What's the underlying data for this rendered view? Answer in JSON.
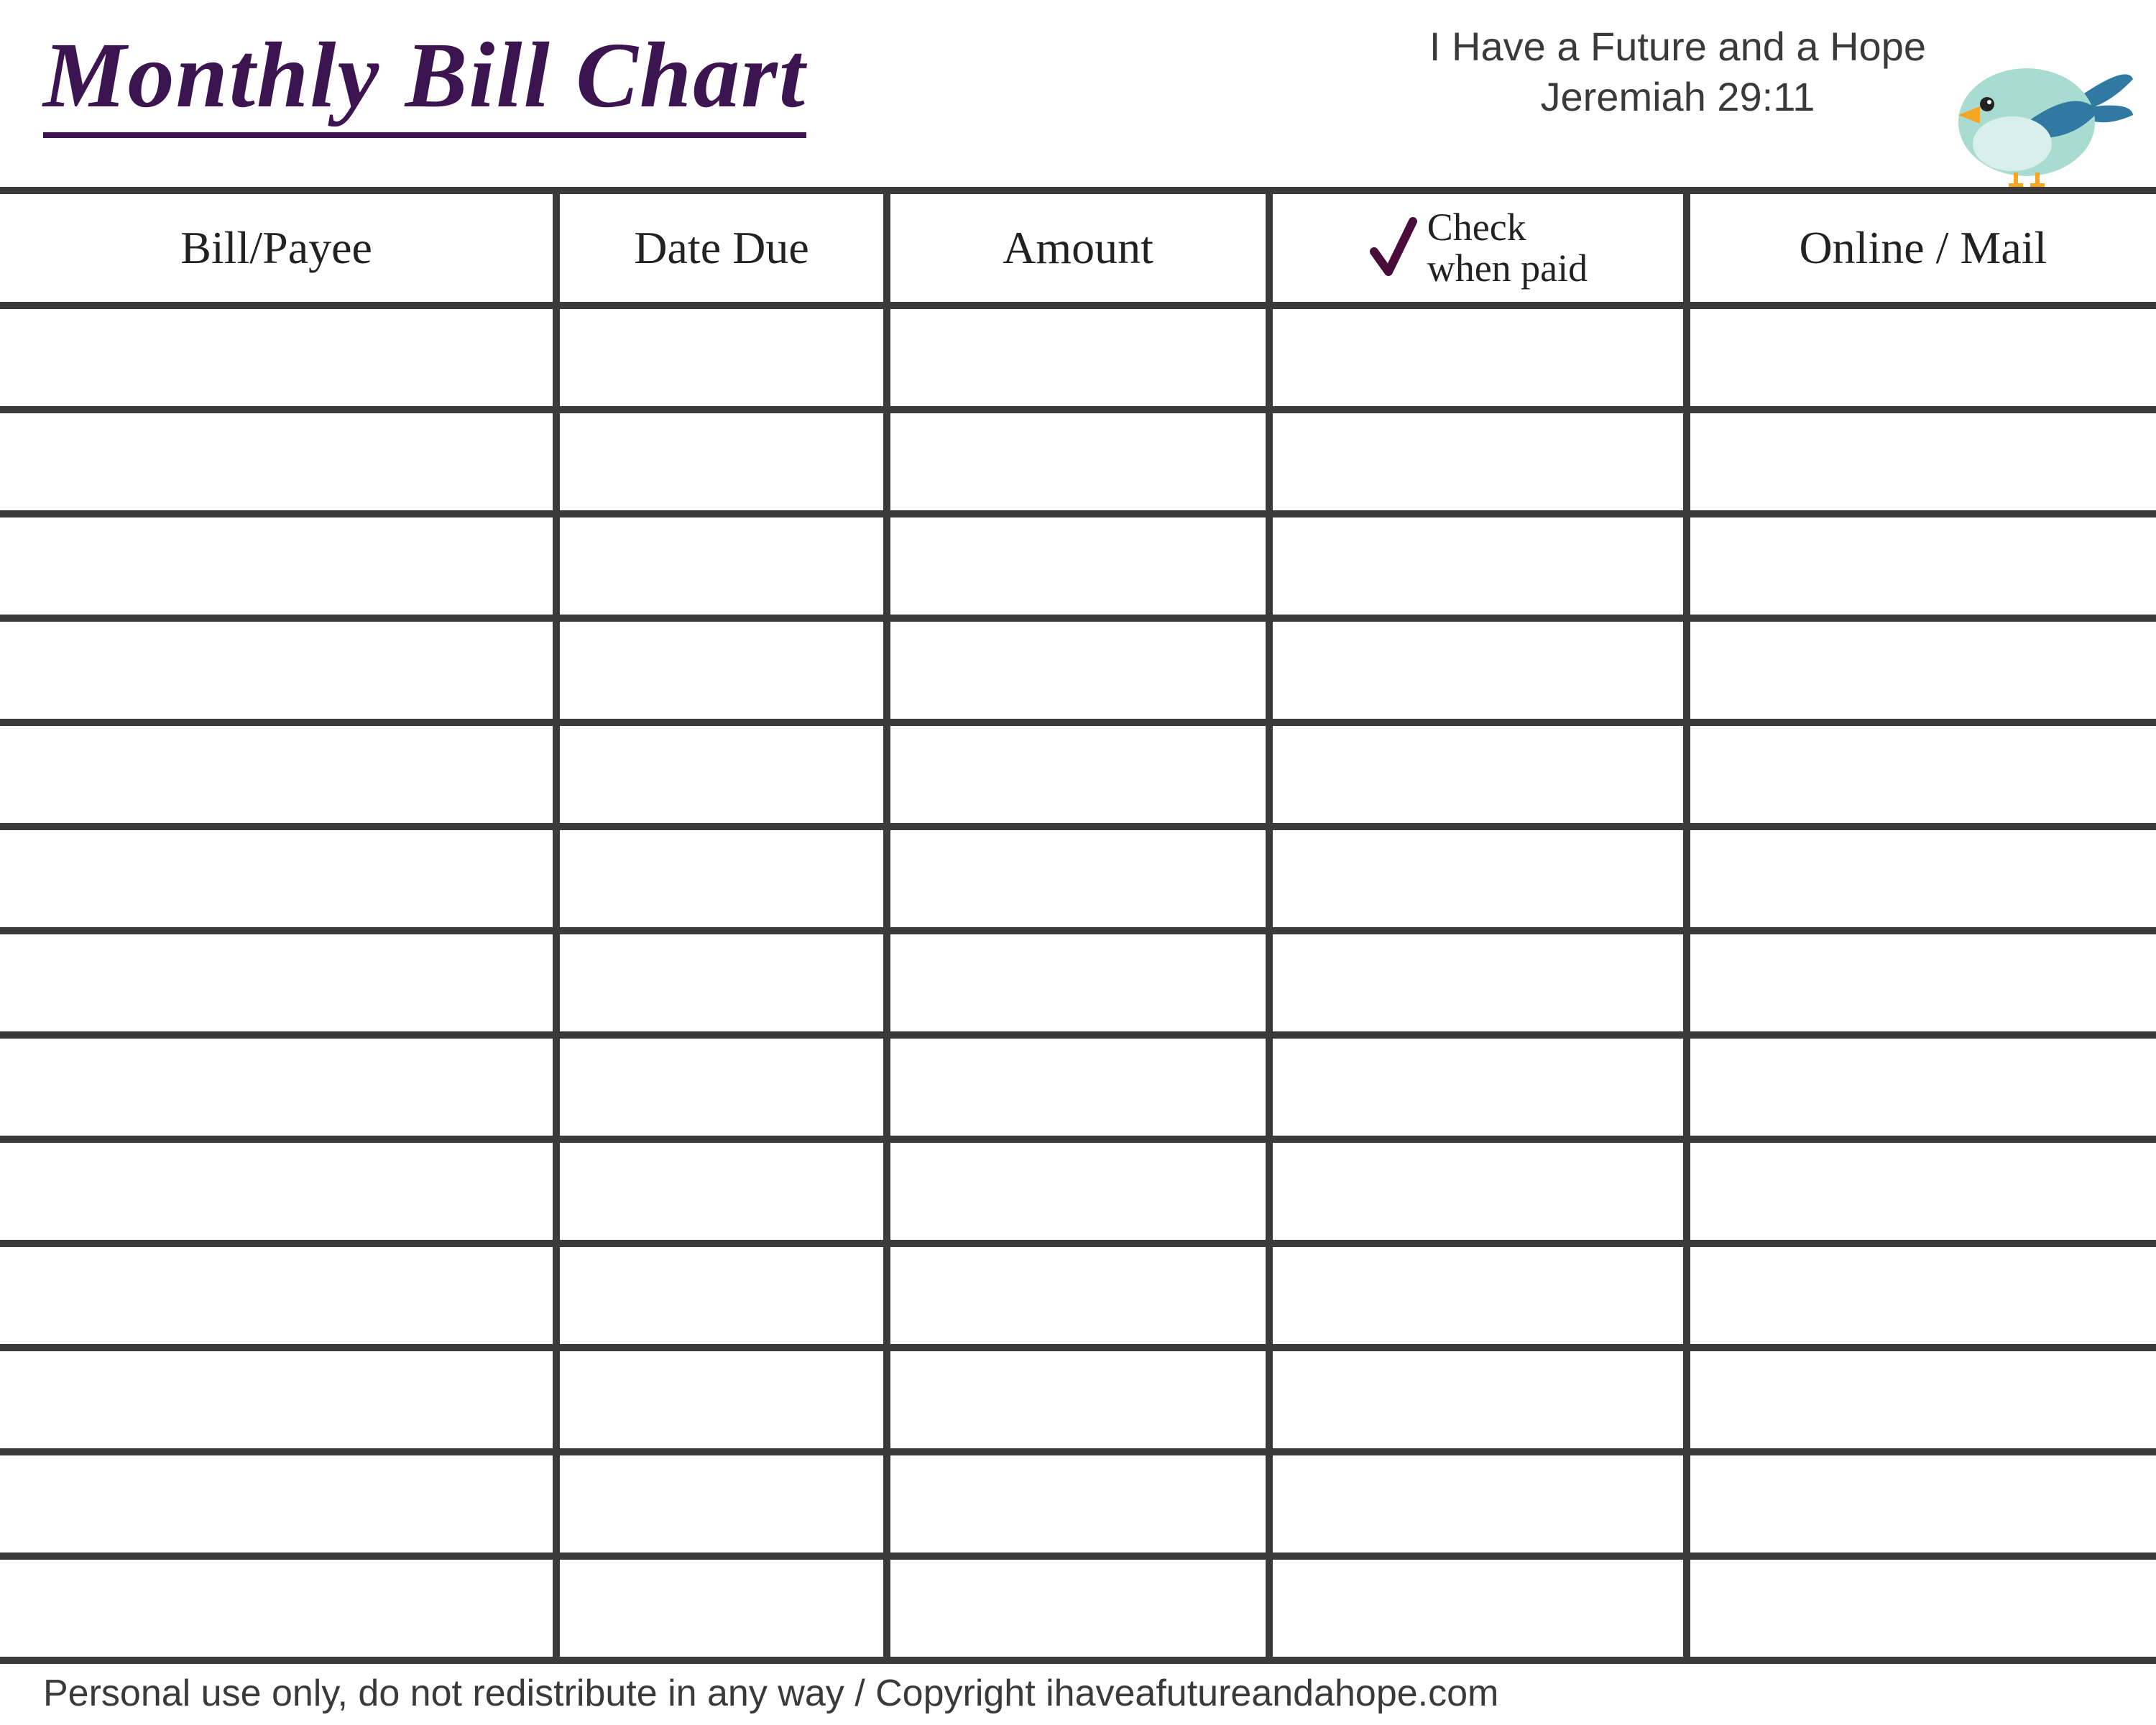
{
  "header": {
    "title": "Monthly Bill Chart",
    "tagline_line1": "I Have a Future and a Hope",
    "tagline_line2": "Jeremiah 29:11"
  },
  "table": {
    "columns": {
      "bill_payee": "Bill/Payee",
      "date_due": "Date Due",
      "amount": "Amount",
      "check_when_paid_line1": "Check",
      "check_when_paid_line2": "when paid",
      "online_mail": "Online / Mail"
    },
    "row_count": 13
  },
  "footer": {
    "text": "Personal use only, do not redistribute in any way / Copyright ihaveafutureandahope.com"
  },
  "colors": {
    "title_purple": "#3c1450",
    "grid": "#3a3a3a",
    "bird_body": "#a9dcd1",
    "bird_wing": "#2f79a3",
    "bird_beak": "#f5a623"
  }
}
